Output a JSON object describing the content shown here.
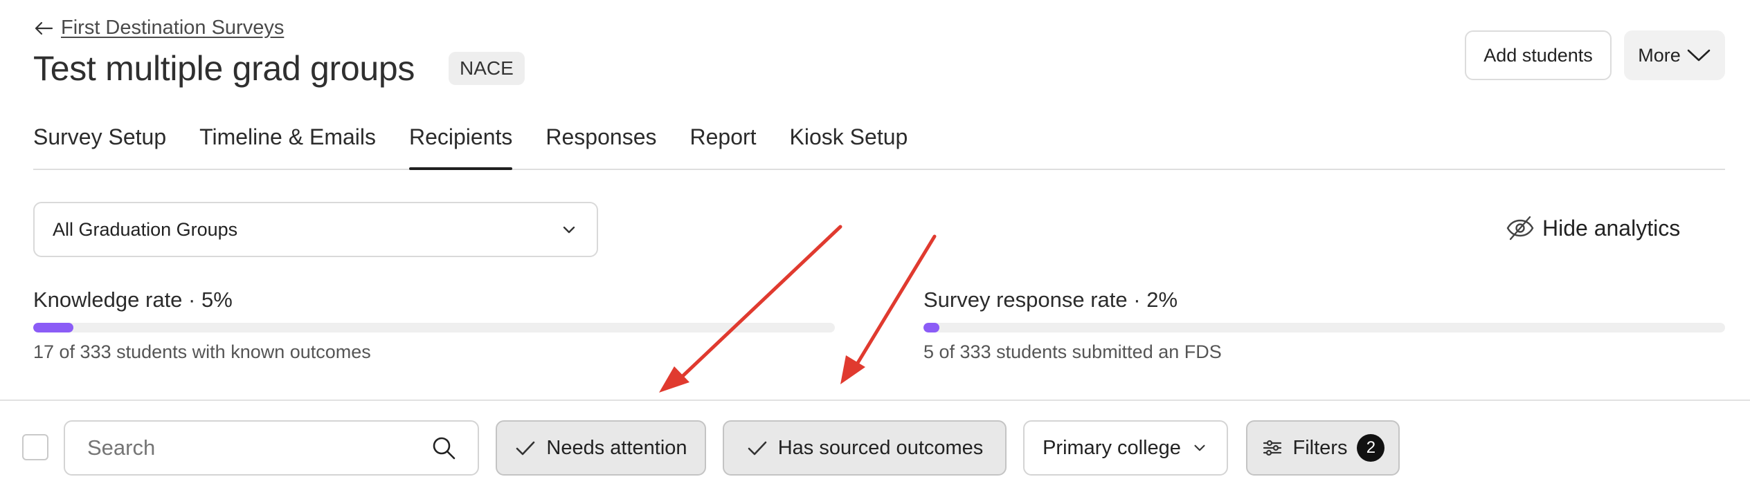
{
  "header": {
    "back_link": "First Destination Surveys",
    "title": "Test multiple grad groups",
    "badge": "NACE",
    "add_students": "Add students",
    "more": "More"
  },
  "tabs": [
    {
      "label": "Survey Setup",
      "active": false
    },
    {
      "label": "Timeline & Emails",
      "active": false
    },
    {
      "label": "Recipients",
      "active": true
    },
    {
      "label": "Responses",
      "active": false
    },
    {
      "label": "Report",
      "active": false
    },
    {
      "label": "Kiosk Setup",
      "active": false
    }
  ],
  "graduation_select": {
    "value": "All Graduation Groups"
  },
  "analytics": {
    "hide_label": "Hide analytics",
    "knowledge": {
      "title": "Knowledge rate · 5%",
      "percent": 5,
      "subtitle": "17 of 333 students with known outcomes"
    },
    "response": {
      "title": "Survey response rate · 2%",
      "percent": 2,
      "subtitle": "5 of 333 students submitted an FDS"
    }
  },
  "filters": {
    "search_placeholder": "Search",
    "needs_attention": "Needs attention",
    "has_sourced_outcomes": "Has sourced outcomes",
    "primary_college": "Primary college",
    "filters_label": "Filters",
    "filters_count": "2"
  },
  "colors": {
    "accent": "#8b5cf6",
    "annotation_arrow": "#e03a2f"
  }
}
